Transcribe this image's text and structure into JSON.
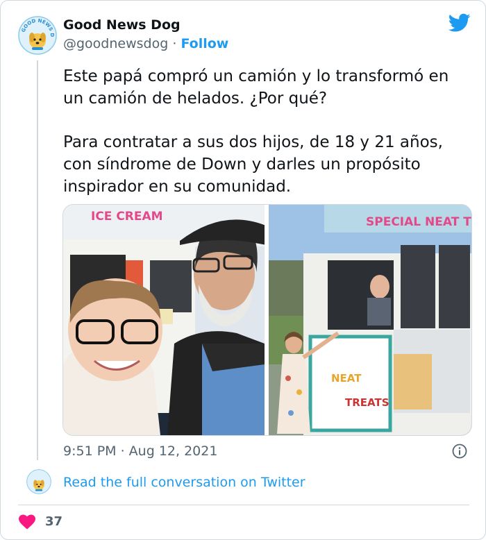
{
  "tweet": {
    "author": {
      "display_name": "Good News Dog",
      "handle": "@goodnewsdog",
      "separator": "·",
      "follow_label": "Follow",
      "avatar_text": "GOOD NEWS DOG"
    },
    "paragraphs": [
      "Este papá compró un camión y lo transformó en un camión de helados. ¿Por qué?",
      "Para contratar a sus dos hijos, de 18 y 21 años, con síndrome de Down y darles un propósito inspirador en su comunidad."
    ],
    "media": {
      "photo_left_truck_sign": "ICE CREAM",
      "photo_right_truck_sign": "SPECIAL NEAT TREATS",
      "photo_right_side_text": [
        "NEAT",
        "TREATS"
      ]
    },
    "timestamp": "9:51 PM · Aug 12, 2021",
    "read_more": "Read the full conversation on Twitter",
    "likes": "37"
  },
  "colors": {
    "accent": "#1d9bf0",
    "heart": "#f91880",
    "secondary_text": "#536471",
    "border": "#cfd9de"
  },
  "icons": {
    "brand": "twitter-bird-icon",
    "info": "info-icon",
    "like": "heart-icon"
  }
}
